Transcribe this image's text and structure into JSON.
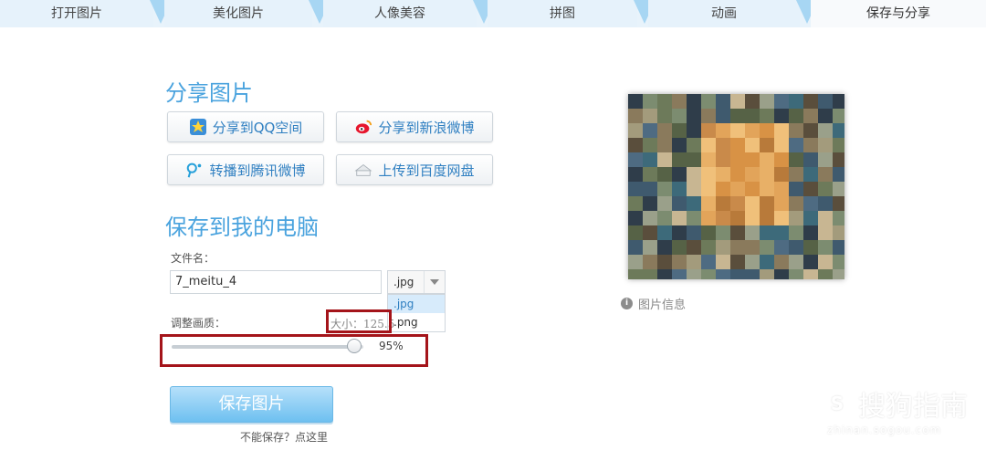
{
  "tabs": [
    {
      "label": "打开图片",
      "active": false
    },
    {
      "label": "美化图片",
      "active": false
    },
    {
      "label": "人像美容",
      "active": false
    },
    {
      "label": "拼图",
      "active": false
    },
    {
      "label": "动画",
      "active": false
    },
    {
      "label": "保存与分享",
      "active": true
    }
  ],
  "share": {
    "title": "分享图片",
    "buttons": [
      {
        "label": "分享到QQ空间",
        "icon": "qzone-star-icon"
      },
      {
        "label": "分享到新浪微博",
        "icon": "weibo-icon"
      },
      {
        "label": "转播到腾讯微博",
        "icon": "tencent-weibo-icon"
      },
      {
        "label": "上传到百度网盘",
        "icon": "baidu-cloud-icon"
      }
    ]
  },
  "save": {
    "title": "保存到我的电脑",
    "filename_label": "文件名：",
    "filename_value": "7_meitu_4",
    "format_selected": ".jpg",
    "format_options": [
      ".jpg",
      ".png"
    ],
    "quality_label": "调整画质：",
    "size_text": "大小：125.5",
    "quality_percent": "95%",
    "quality_value": 0.95,
    "save_button": "保存图片",
    "help_link": "不能保存？点这里"
  },
  "preview": {
    "info_label": "图片信息"
  },
  "watermark": {
    "logo_letter": "S",
    "main": "搜狗指南",
    "sub": "zhinan.sogou.com"
  },
  "colors": {
    "accent": "#4aa3de",
    "highlight_box": "#a4141a",
    "save_button": "#6ec0f0"
  }
}
